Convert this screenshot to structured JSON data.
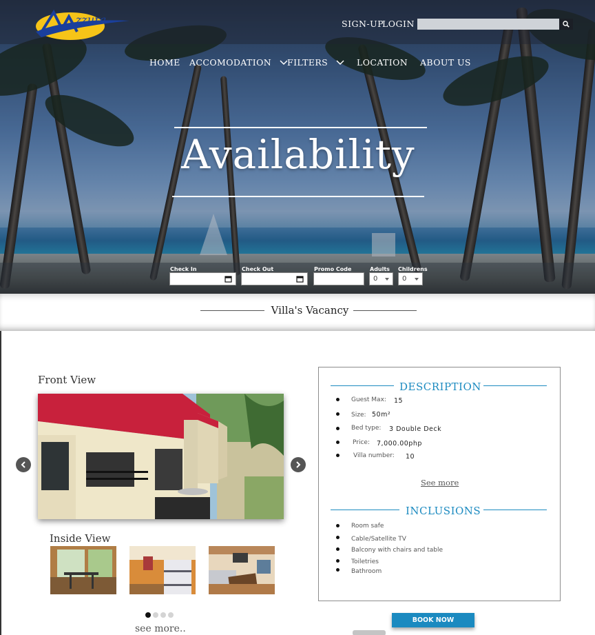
{
  "header": {
    "logo_text": "Azzura",
    "signup_label": "SIGN-UP",
    "login_label": "LOGIN",
    "search_value": ""
  },
  "nav": {
    "items": [
      {
        "label": "HOME"
      },
      {
        "label": "ACCOMODATION"
      },
      {
        "label": "FILTERS"
      },
      {
        "label": "LOCATION"
      },
      {
        "label": "ABOUT US"
      }
    ]
  },
  "hero": {
    "title": "Availability"
  },
  "booking": {
    "check_in_label": "Check In",
    "check_out_label": "Check Out",
    "promo_label": "Promo Code",
    "adults_label": "Adults",
    "children_label": "Childrens",
    "check_in_value": "",
    "check_out_value": "",
    "promo_value": "",
    "adults_value": "0",
    "children_value": "0"
  },
  "vacancy": {
    "title": "Villa's Vacancy"
  },
  "gallery": {
    "front_label": "Front View",
    "inside_label": "Inside View",
    "see_more": "see more..",
    "dots_count": 4,
    "active_dot": 0
  },
  "description": {
    "heading": "DESCRIPTION",
    "specs": [
      {
        "label": "Guest Max:",
        "value": "15"
      },
      {
        "label": "Size:",
        "value": "50m²"
      },
      {
        "label": "Bed type:",
        "value": "3 Double Deck"
      },
      {
        "label": "Price:",
        "value": "7,000.00php"
      },
      {
        "label": "Villa number:",
        "value": "10"
      }
    ],
    "see_more": "See more"
  },
  "inclusions": {
    "heading": "INCLUSIONS",
    "items": [
      "Room safe",
      "Cable/Satellite TV",
      "Balcony with chairs and table",
      "Toiletries",
      "Bathroom"
    ]
  },
  "actions": {
    "book_now": "BOOK NOW"
  },
  "colors": {
    "accent": "#1b8ac0",
    "roof": "#c8213c",
    "logo_yellow": "#f6c418",
    "logo_blue": "#1a3f9c"
  }
}
